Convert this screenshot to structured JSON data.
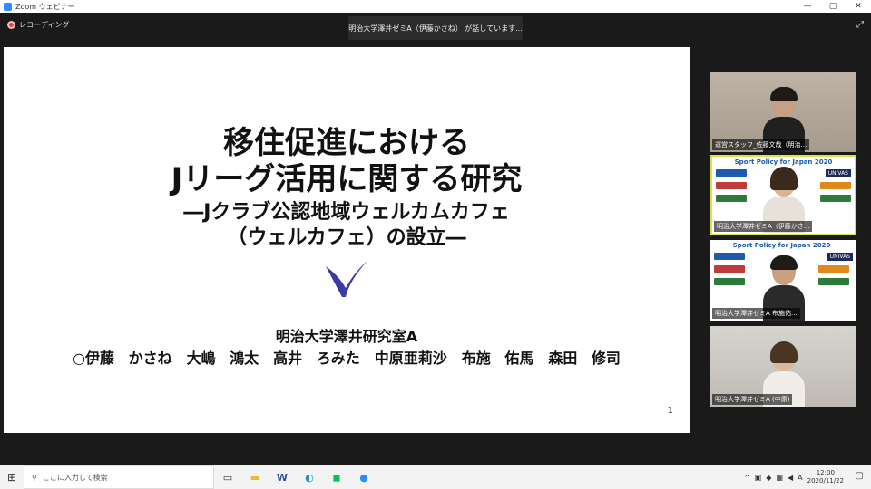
{
  "window": {
    "title": "Zoom ウェビナー",
    "controls": [
      "—",
      "▢",
      "✕"
    ]
  },
  "meeting": {
    "recording_label": "レコーディング",
    "speaking_banner": "明治大学澤井ゼミA（伊藤かさね） が話しています...",
    "expand_icon": "⤢"
  },
  "slide": {
    "title_line1": "移住促進における",
    "title_line2": "Jリーグ活用に関する研究",
    "subtitle_line1": "―Jクラブ公認地域ウェルカムカフェ",
    "subtitle_line2": "（ウェルカフェ）の設立―",
    "lab": "明治大学澤井研究室A",
    "members": "○伊藤 かさね　大嶋 鴻太　高井 ろみた　中原亜莉沙　布施 佑馬　森田 修司",
    "page_number": "1",
    "logo_color": "#3b3aa8"
  },
  "participants": [
    {
      "name": "運営スタッフ_佐藤文哉（明治...",
      "kind": "camera",
      "active": false
    },
    {
      "name": "明治大学澤井ゼミA（伊藤かさ...",
      "kind": "banner",
      "active": true,
      "banner_title": "Sport Policy for Japan 2020",
      "banner_brand": "UNIVAS"
    },
    {
      "name": "明治大学澤井ゼミA 布施佑...",
      "kind": "banner",
      "active": false,
      "banner_title": "Sport Policy for Japan 2020",
      "banner_brand": "UNIVAS"
    },
    {
      "name": "明治大学澤井ゼミA (中原)",
      "kind": "office",
      "active": false
    }
  ],
  "taskbar": {
    "search_placeholder": "ここに入力して検索",
    "apps": [
      "task-view",
      "file-explorer",
      "word",
      "edge",
      "line",
      "zoom"
    ],
    "tray_ime": "A",
    "time": "12:00",
    "date": "2020/11/22"
  }
}
